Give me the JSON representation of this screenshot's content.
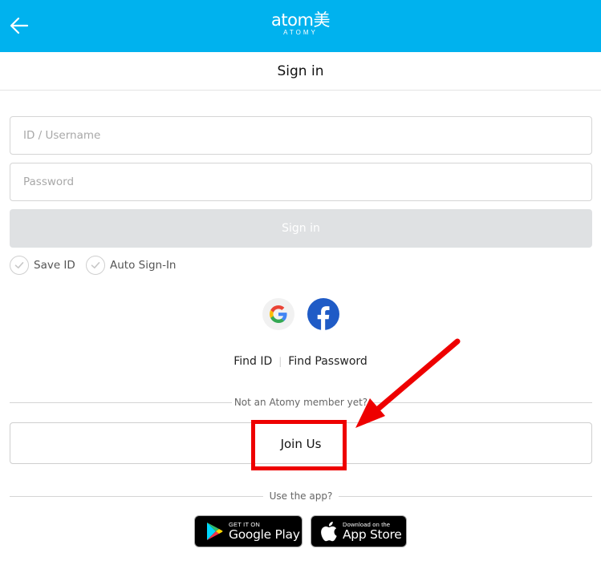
{
  "header": {
    "logo_main": "atom美",
    "logo_sub": "ATOMY",
    "title": "Sign in",
    "accent_color": "#00b2ee"
  },
  "form": {
    "id_placeholder": "ID / Username",
    "id_value": "",
    "password_placeholder": "Password",
    "password_value": "",
    "signin_label": "Sign in",
    "save_id_label": "Save ID",
    "auto_signin_label": "Auto Sign-In"
  },
  "social": {
    "google_icon": "google-icon",
    "facebook_icon": "facebook-icon"
  },
  "links": {
    "find_id": "Find ID",
    "separator": "|",
    "find_password": "Find Password"
  },
  "join": {
    "prompt": "Not an Atomy member yet?",
    "button_label": "Join Us"
  },
  "app": {
    "prompt": "Use the app?",
    "google_play_small": "GET IT ON",
    "google_play_big": "Google Play",
    "app_store_small": "Download on the",
    "app_store_big": "App Store"
  },
  "annotation": {
    "color": "#ee0000"
  }
}
